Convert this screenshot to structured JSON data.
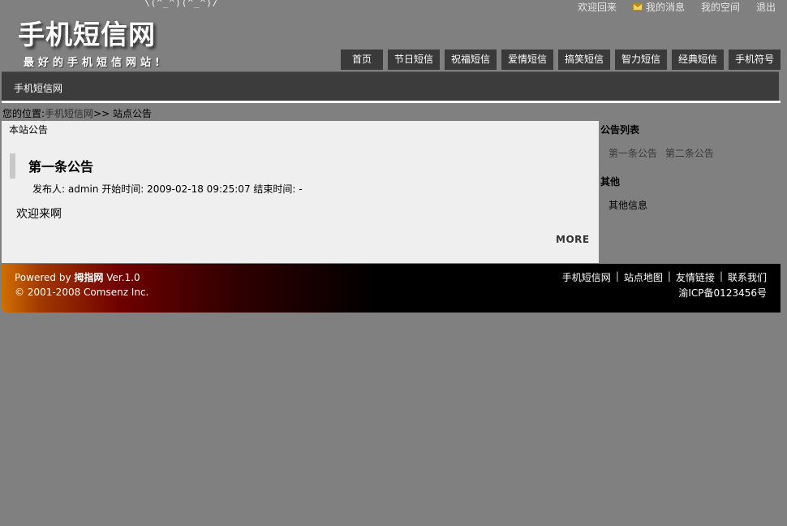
{
  "header": {
    "emoticon": "\\(^_^)(^_^)/",
    "logo_title": "手机短信网",
    "logo_slogan": "最好的手机短信网站!",
    "top_links": {
      "welcome": "欢迎回来",
      "messages": "我的消息",
      "space": "我的空间",
      "logout": "退出"
    },
    "nav": [
      {
        "label": "首页"
      },
      {
        "label": "节日短信"
      },
      {
        "label": "祝福短信"
      },
      {
        "label": "爱情短信"
      },
      {
        "label": "搞笑短信"
      },
      {
        "label": "智力短信"
      },
      {
        "label": "经典短信"
      },
      {
        "label": "手机符号"
      }
    ],
    "subbar": "手机短信网"
  },
  "breadcrumb": {
    "prefix": "您的位置:",
    "home": "手机短信网",
    "sep": ">>",
    "current": " 站点公告"
  },
  "main": {
    "header": "本站公告",
    "notice": {
      "title": "第一条公告",
      "meta": "发布人: admin 开始时间: 2009-02-18 09:25:07 结束时间: -",
      "body": "欢迎来啊"
    },
    "more": "MORE"
  },
  "sidebar": {
    "list_heading": "公告列表",
    "list": [
      "第一条公告",
      "第二条公告"
    ],
    "other_heading": "其他",
    "other_item": "其他信息"
  },
  "footer": {
    "powered_prefix": "Powered by ",
    "powered_brand": "拇指网",
    "powered_version": " Ver.1.0",
    "copyright": "© 2001-2008 Comsenz Inc.",
    "links": [
      "手机短信网",
      "站点地图",
      "友情链接",
      "联系我们"
    ],
    "icp": "渝ICP备0123456号"
  },
  "colors": {
    "page_bg": "#808080",
    "nav_bg": "#3a3a3a",
    "panel_bg": "#efefef",
    "footer_accent": "#d07000"
  }
}
